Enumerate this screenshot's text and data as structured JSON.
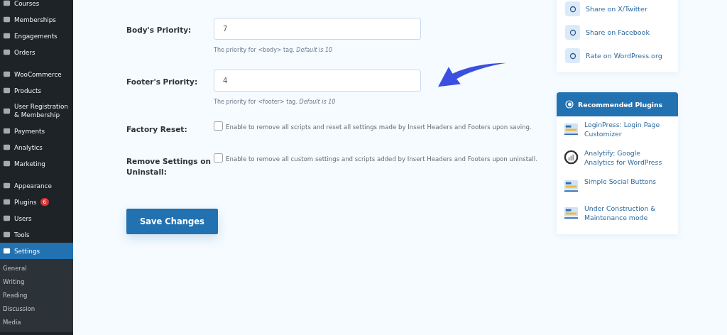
{
  "sidebar": {
    "groups": [
      [
        {
          "label": "Courses",
          "selected": false
        },
        {
          "label": "Memberships",
          "selected": false
        },
        {
          "label": "Engagements",
          "selected": false
        },
        {
          "label": "Orders",
          "selected": false
        }
      ],
      [
        {
          "label": "WooCommerce",
          "selected": false
        },
        {
          "label": "Products",
          "selected": false
        },
        {
          "label": "User Registration & Membership",
          "selected": false
        },
        {
          "label": "Payments",
          "selected": false
        },
        {
          "label": "Analytics",
          "selected": false
        },
        {
          "label": "Marketing",
          "selected": false
        }
      ],
      [
        {
          "label": "Appearance",
          "selected": false
        },
        {
          "label": "Plugins",
          "selected": false,
          "badge": "6"
        },
        {
          "label": "Users",
          "selected": false
        },
        {
          "label": "Tools",
          "selected": false
        },
        {
          "label": "Settings",
          "selected": true
        }
      ]
    ],
    "submenu": [
      "General",
      "Writing",
      "Reading",
      "Discussion",
      "Media"
    ]
  },
  "fields": [
    {
      "kind": "input",
      "label": "Body's Priority:",
      "value": "7",
      "help": "The priority for <body> tag. *Default is 10*"
    },
    {
      "kind": "input",
      "label": "Footer's Priority:",
      "value": "4",
      "help": "The priority for <footer> tag. *Default is 10*"
    },
    {
      "kind": "checkbox",
      "label": "Factory Reset:",
      "checked": false,
      "text": "Enable to remove all scripts and reset all settings made by Insert Headers and Footers upon saving."
    },
    {
      "kind": "checkbox",
      "label": "Remove Settings on Uninstall:",
      "checked": false,
      "text": "Enable to remove all custom settings and scripts added by Insert Headers and Footers upon uninstall."
    }
  ],
  "save_button": "Save Changes",
  "share_links": [
    "Share on X/Twitter",
    "Share on Facebook",
    "Rate on WordPress.org"
  ],
  "recommended": {
    "title": "Recommended Plugins",
    "plugins": [
      "LoginPress: Login Page Customizer",
      "Analytify: Google Analytics for WordPress",
      "Simple Social Buttons",
      "Under Construction & Maintenance mode"
    ]
  }
}
